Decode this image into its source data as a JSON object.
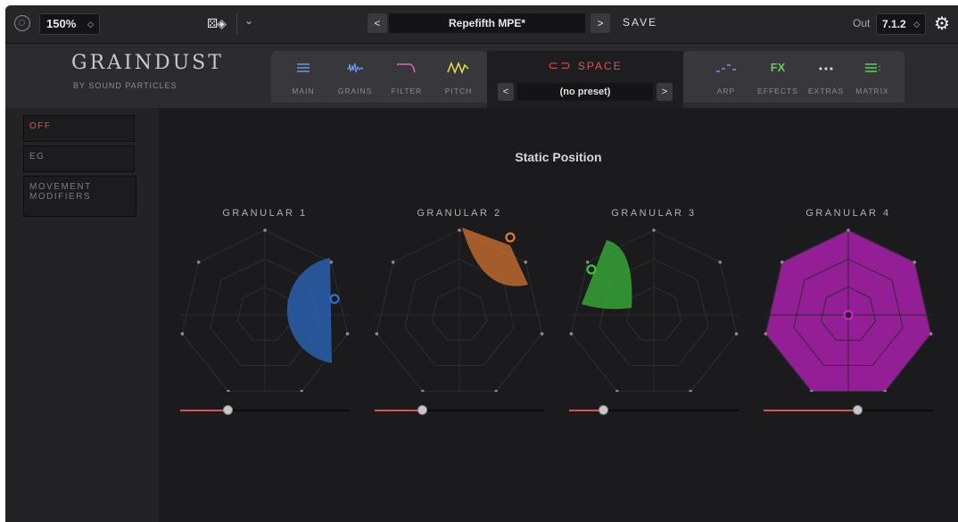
{
  "topbar": {
    "zoom": "150%",
    "preset_prev": "<",
    "preset_name": "Repefifth MPE*",
    "preset_next": ">",
    "save_label": "SAVE",
    "out_label": "Out",
    "out_value": "7.1.2"
  },
  "brand": {
    "name": "GRAINDUST",
    "sub": "BY SOUND PARTICLES"
  },
  "tabs_left": [
    {
      "label": "MAIN",
      "icon": "main-lines-icon",
      "color": "#7aa8ff"
    },
    {
      "label": "GRAINS",
      "icon": "grains-waveform-icon",
      "color": "#7aa8ff"
    },
    {
      "label": "FILTER",
      "icon": "filter-curve-icon",
      "color": "#e066c8"
    },
    {
      "label": "PITCH",
      "icon": "pitch-wave-icon",
      "color": "#e8e04a"
    }
  ],
  "space": {
    "label": "SPACE",
    "preset": "(no preset)",
    "prev": "<",
    "next": ">",
    "color": "#e0524a"
  },
  "tabs_right": [
    {
      "label": "ARP",
      "icon": "arp-steps-icon",
      "color": "#a678ff"
    },
    {
      "label": "EFFECTS",
      "icon": "fx-text-icon",
      "glyph": "FX",
      "color": "#5ad05a"
    },
    {
      "label": "EXTRAS",
      "icon": "extras-dots-icon",
      "color": "#d0d0d6"
    },
    {
      "label": "MATRIX",
      "icon": "matrix-lines-icon",
      "color": "#5ad05a"
    }
  ],
  "sidebar": {
    "items": [
      {
        "label": "OFF",
        "active": true
      },
      {
        "label": "EG",
        "active": false
      },
      {
        "label": "MOVEMENT MODIFIERS",
        "active": false
      }
    ]
  },
  "main": {
    "title": "Static Position",
    "granulars": [
      {
        "label": "GRANULAR 1",
        "color": "#2f6fcf",
        "slider": 0.28
      },
      {
        "label": "GRANULAR 2",
        "color": "#e07a30",
        "slider": 0.28
      },
      {
        "label": "GRANULAR 3",
        "color": "#3cc43c",
        "slider": 0.2
      },
      {
        "label": "GRANULAR 4",
        "color": "#d020d0",
        "slider": 0.55
      }
    ]
  }
}
